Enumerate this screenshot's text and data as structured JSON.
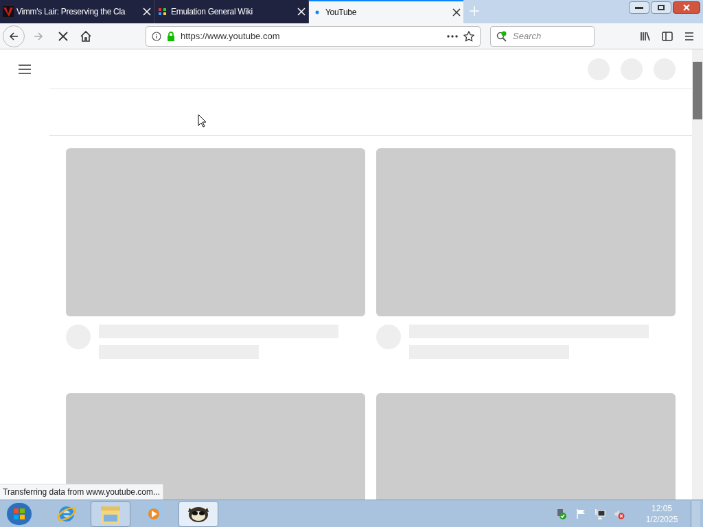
{
  "tabs": [
    {
      "title": "Vimm's Lair: Preserving the Cla",
      "selected": false,
      "kind": "vimm"
    },
    {
      "title": "Emulation General Wiki",
      "selected": false,
      "kind": "wiki"
    },
    {
      "title": "YouTube",
      "selected": true,
      "kind": "loading"
    }
  ],
  "toolbar": {
    "loading": true,
    "url": "https://www.youtube.com",
    "secure": true,
    "search_placeholder": "Search"
  },
  "status_text": "Transferring data from www.youtube.com...",
  "taskbar": {
    "items": [
      {
        "kind": "ie",
        "running": false,
        "selected": false
      },
      {
        "kind": "explorer",
        "running": true,
        "selected": false
      },
      {
        "kind": "media",
        "running": false,
        "selected": false
      },
      {
        "kind": "raccoon",
        "running": true,
        "selected": true
      }
    ],
    "clock": {
      "time": "12:05",
      "date": "1/2/2025"
    }
  }
}
